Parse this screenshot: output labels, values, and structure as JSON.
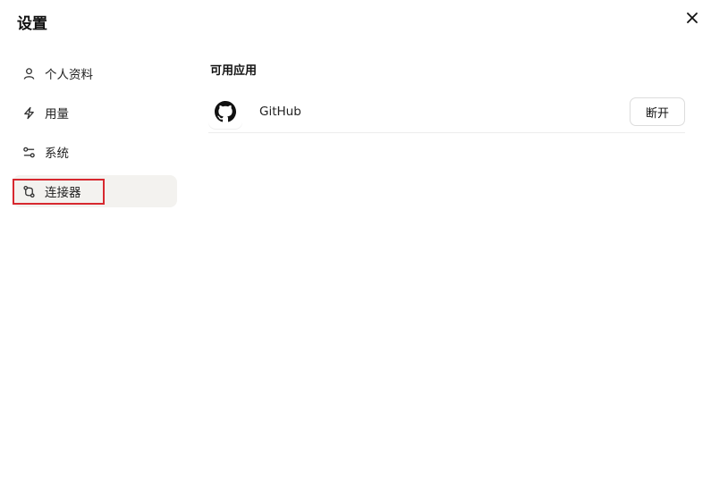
{
  "dialog": {
    "title": "设置",
    "close_icon": "close-icon"
  },
  "sidebar": {
    "items": [
      {
        "label": "个人资料",
        "icon": "user-icon",
        "active": false
      },
      {
        "label": "用量",
        "icon": "lightning-icon",
        "active": false
      },
      {
        "label": "系统",
        "icon": "sliders-icon",
        "active": false
      },
      {
        "label": "连接器",
        "icon": "git-compare-icon",
        "active": true
      }
    ]
  },
  "main": {
    "section_title": "可用应用",
    "apps": [
      {
        "name": "GitHub",
        "icon": "github-icon",
        "action_label": "断开"
      }
    ]
  },
  "colors": {
    "active_bg": "#f3f2ef",
    "highlight": "#d7282f",
    "divider": "#ececec"
  }
}
